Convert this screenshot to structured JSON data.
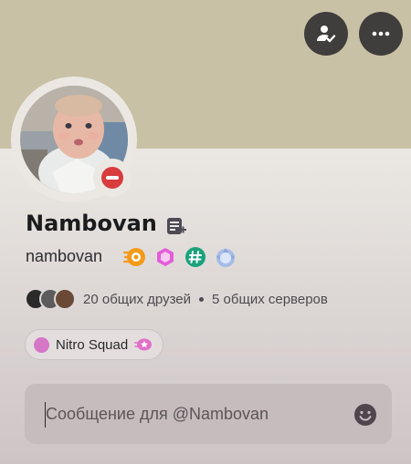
{
  "profile": {
    "display_name": "Nambovan",
    "username": "nambovan",
    "status": "do-not-disturb",
    "badges": [
      "hypesquad-icon",
      "nitro-gem-icon",
      "hashtag-icon",
      "boost-icon"
    ]
  },
  "top_actions": [
    "add-friend-icon",
    "more-icon"
  ],
  "mutual": {
    "friends_text": "20 общих друзей",
    "servers_text": "5 общих серверов"
  },
  "role": {
    "label": "Nitro Squad",
    "color": "#d477c7"
  },
  "message": {
    "placeholder": "Сообщение для @Nambovan"
  },
  "colors": {
    "banner": "#c8c1a6",
    "button_bg": "#403e3c",
    "dnd_red": "#d83c3e"
  }
}
